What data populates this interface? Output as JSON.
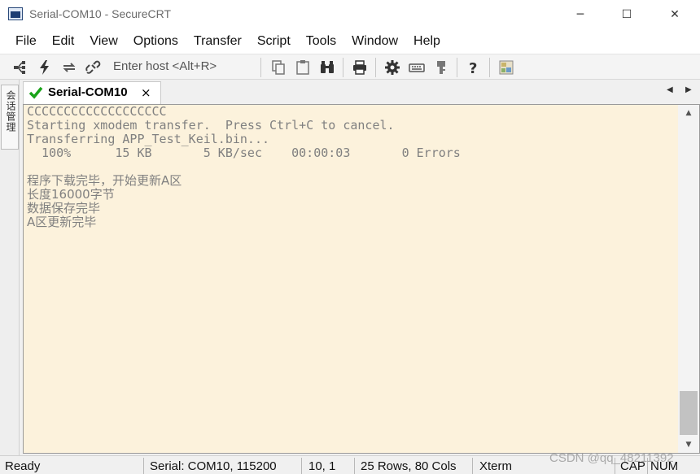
{
  "window": {
    "title": "Serial-COM10 - SecureCRT",
    "minimize_glyph": "─",
    "maximize_glyph": "☐",
    "close_glyph": "✕"
  },
  "menu": {
    "items": [
      "File",
      "Edit",
      "View",
      "Options",
      "Transfer",
      "Script",
      "Tools",
      "Window",
      "Help"
    ]
  },
  "toolbar": {
    "host_placeholder": "Enter host <Alt+R>",
    "icons": [
      "connect-icon",
      "quick-connect-icon",
      "reconnect-icon",
      "disconnect-icon",
      "copy-icon",
      "paste-icon",
      "find-icon",
      "print-icon",
      "settings-icon",
      "keymap-icon",
      "sftp-icon",
      "help-icon",
      "custom-icon"
    ]
  },
  "side_panel": {
    "label": "会话管理"
  },
  "tab": {
    "label": "Serial-COM10",
    "close": "×",
    "status_color": "#1aa31a"
  },
  "terminal": {
    "background": "#fcf2dc",
    "text_color": "#808080",
    "lines": [
      "CCCCCCCCCCCCCCCCCCC",
      "Starting xmodem transfer.  Press Ctrl+C to cancel.",
      "Transferring APP_Test_Keil.bin...",
      "  100%      15 KB       5 KB/sec    00:00:03       0 Errors",
      "",
      "程序下载完毕，开始更新A区",
      "长度16000字节",
      "数据保存完毕",
      "A区更新完毕"
    ]
  },
  "status": {
    "ready": "Ready",
    "connection": "Serial: COM10, 115200",
    "cursor": "10,  1",
    "size": "25 Rows, 80 Cols",
    "terminal_type": "Xterm",
    "cap": "CAP",
    "num": "NUM"
  },
  "watermark": "CSDN @qq_48211392"
}
